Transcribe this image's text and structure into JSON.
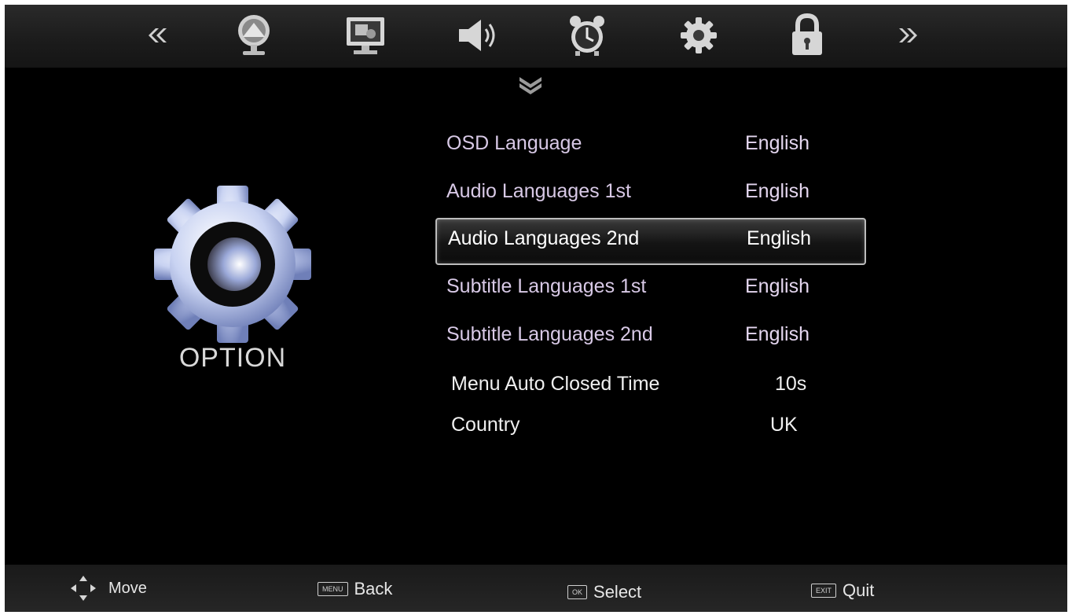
{
  "nav": {
    "icons": [
      "picture-icon",
      "screen-icon",
      "sound-icon",
      "timer-icon",
      "settings-icon",
      "lock-icon"
    ]
  },
  "section": {
    "title": "OPTION",
    "icon": "gear-icon"
  },
  "menu": {
    "items": [
      {
        "label": "OSD Language",
        "value": "English"
      },
      {
        "label": "Audio Languages 1st",
        "value": "English"
      },
      {
        "label": "Audio Languages 2nd",
        "value": "English"
      },
      {
        "label": "Subtitle Languages 1st",
        "value": "English"
      },
      {
        "label": "Subtitle Languages 2nd",
        "value": "English"
      },
      {
        "label": "Menu Auto Closed Time",
        "value": "10s"
      },
      {
        "label": "Country",
        "value": "UK"
      }
    ],
    "selected_index": 2
  },
  "footer": {
    "move": "Move",
    "back_key": "MENU",
    "back": "Back",
    "select_key": "OK",
    "select": "Select",
    "quit_key": "EXIT",
    "quit": "Quit"
  },
  "colors": {
    "background": "#000000",
    "menu_text": "#d8c9e6",
    "bar": "#1f1f1f"
  }
}
